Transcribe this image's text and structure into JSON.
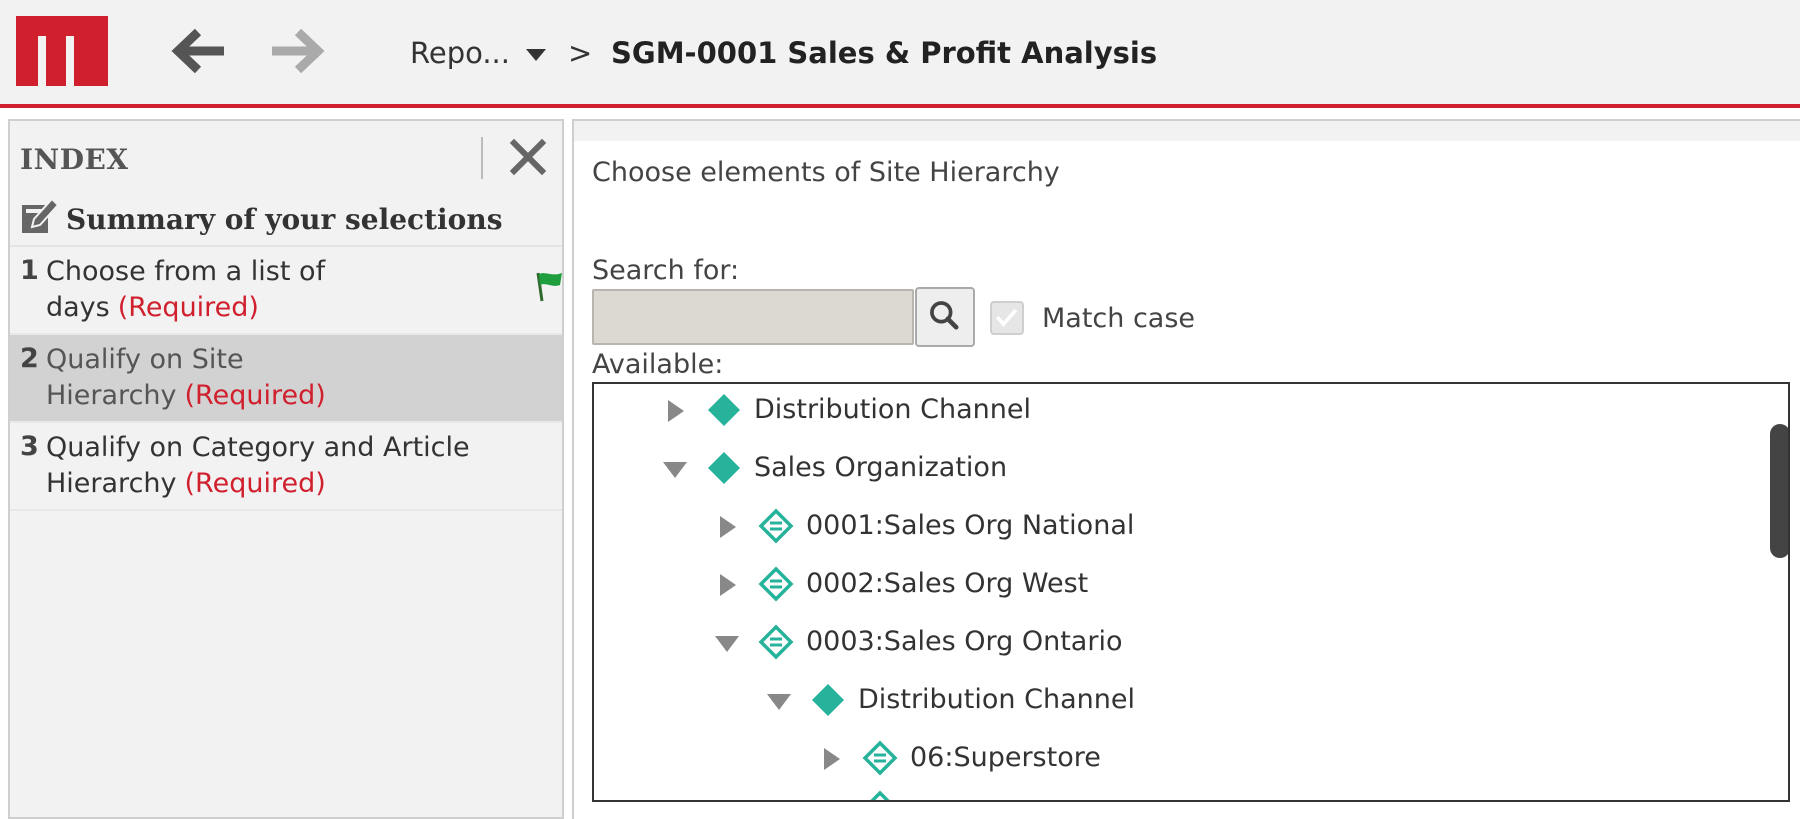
{
  "colors": {
    "brand": "#d0202e",
    "teal": "#26b29b",
    "required": "#d0202e",
    "selected_row": "#d2d2d2"
  },
  "header": {
    "logo_icon": "m-logo",
    "back_icon": "arrow-left",
    "forward_icon": "arrow-right",
    "breadcrumb_parent": "Repo...",
    "breadcrumb_separator": ">",
    "title": "SGM-0001 Sales & Profit Analysis"
  },
  "index": {
    "title": "INDEX",
    "close_icon": "close-x",
    "summary_label": "Summary of your selections",
    "steps": [
      {
        "num": "1",
        "line1": "Choose from a list of",
        "line2": "days",
        "required": "(Required)",
        "flag_icon": "green-flag"
      },
      {
        "num": "2",
        "line1": "Qualify on Site",
        "line2": "Hierarchy",
        "required": "(Required)"
      },
      {
        "num": "3",
        "line1": "Qualify on Category and Article",
        "line2": "Hierarchy",
        "required": "(Required)"
      }
    ]
  },
  "main": {
    "heading": "Choose elements of Site Hierarchy",
    "search_label": "Search for:",
    "search_value": "",
    "search_icon": "magnifier",
    "match_case_label": "Match case",
    "match_case_checked": true,
    "available_label": "Available:",
    "tree": [
      {
        "label": "Distribution Channel",
        "depth": 0,
        "expanded": false,
        "icon": "diamond-solid"
      },
      {
        "label": "Sales Organization",
        "depth": 0,
        "expanded": true,
        "icon": "diamond-solid"
      },
      {
        "label": "0001:Sales Org National",
        "depth": 1,
        "expanded": false,
        "icon": "diamond-outline"
      },
      {
        "label": "0002:Sales Org West",
        "depth": 1,
        "expanded": false,
        "icon": "diamond-outline"
      },
      {
        "label": "0003:Sales Org Ontario",
        "depth": 1,
        "expanded": true,
        "icon": "diamond-outline"
      },
      {
        "label": "Distribution Channel",
        "depth": 2,
        "expanded": true,
        "icon": "diamond-solid"
      },
      {
        "label": "06:Superstore",
        "depth": 3,
        "expanded": false,
        "icon": "diamond-outline"
      }
    ]
  }
}
